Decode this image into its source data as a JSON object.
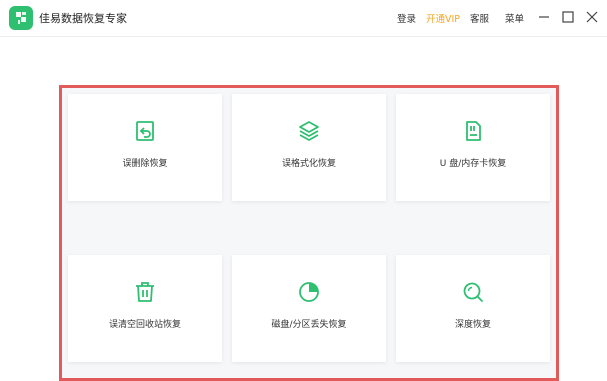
{
  "app": {
    "title": "佳易数据恢复专家"
  },
  "topbar": {
    "login": "登录",
    "vip": "开通VIP",
    "service": "客服",
    "menu": "菜单"
  },
  "colors": {
    "accent": "#2fbf71",
    "vip": "#f5a623",
    "highlight_border": "#e35a5a"
  },
  "cards": [
    {
      "label": "误删除恢复",
      "icon": "file-restore-icon"
    },
    {
      "label": "误格式化恢复",
      "icon": "layers-icon"
    },
    {
      "label": "U 盘/内存卡恢复",
      "icon": "sd-card-icon"
    },
    {
      "label": "误清空回收站恢复",
      "icon": "trash-icon"
    },
    {
      "label": "磁盘/分区丢失恢复",
      "icon": "pie-chart-icon"
    },
    {
      "label": "深度恢复",
      "icon": "deep-search-icon"
    }
  ]
}
